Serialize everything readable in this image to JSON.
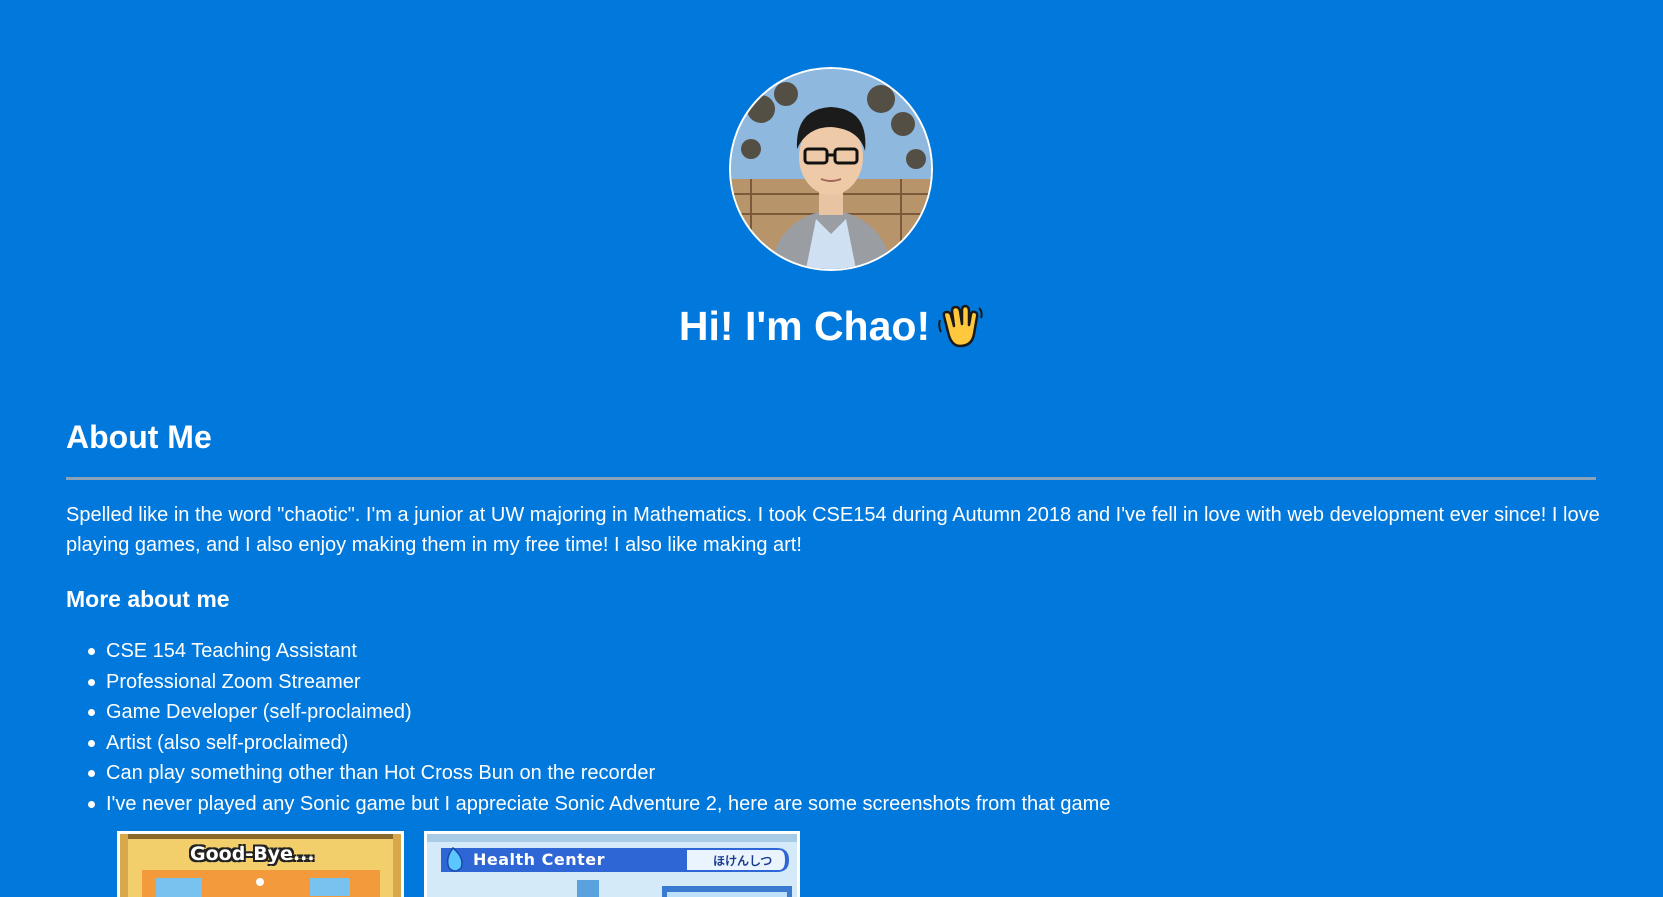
{
  "hero": {
    "greeting": "Hi! I'm Chao!",
    "avatar_icon": "profile-photo",
    "wave_icon": "waving-hand-icon"
  },
  "about": {
    "title": "About Me",
    "intro": "Spelled like in the word \"chaotic\". I'm a junior at UW majoring in Mathematics. I took CSE154 during Autumn 2018 and I've fell in love with web development ever since! I love playing games, and I also enjoy making them in my free time! I also like making art!"
  },
  "more": {
    "title": "More about me",
    "items": [
      "CSE 154 Teaching Assistant",
      "Professional Zoom Streamer",
      "Game Developer (self-proclaimed)",
      "Artist (also self-proclaimed)",
      "Can play something other than Hot Cross Bun on the recorder",
      "I've never played any Sonic game but I appreciate Sonic Adventure 2, here are some screenshots from that game"
    ]
  },
  "screenshots": {
    "goodbye_label": "Good-Bye...",
    "health_label": "Health Center",
    "health_kana": "ほけんしつ"
  },
  "colors": {
    "background": "#0078dc",
    "text": "#ffffff",
    "divider": "#8aa3ba"
  }
}
